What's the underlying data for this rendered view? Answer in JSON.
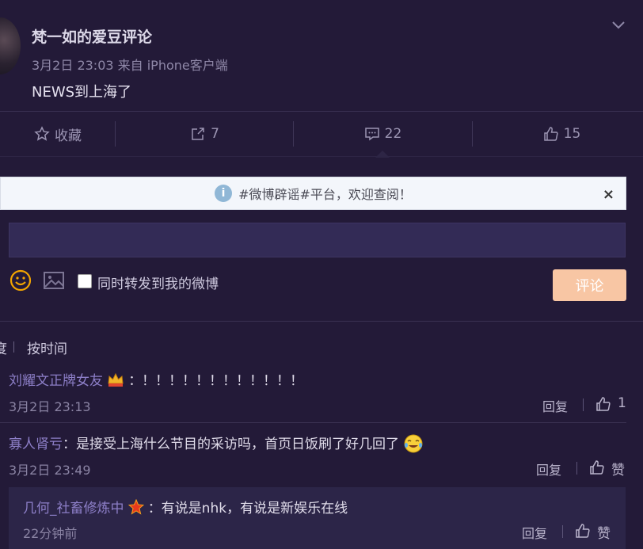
{
  "post": {
    "username": "梵一如的爱豆评论",
    "meta": "3月2日 23:03 来自 iPhone客户端",
    "text": "NEWS到上海了"
  },
  "actions": {
    "favorite_label": "收藏",
    "repost_count": "7",
    "comment_count": "22",
    "like_count": "15"
  },
  "notice": {
    "text": "#微博辟谣#平台，欢迎查阅！",
    "close": "×",
    "info": "i"
  },
  "composer": {
    "checkbox_label": "同时转发到我的微博",
    "submit_label": "评论"
  },
  "sort": {
    "partial": "度",
    "by_time": "按时间"
  },
  "comments": [
    {
      "name": "刘耀文正牌女友",
      "text": "：！！！！！！！！！！！！",
      "time": "3月2日 23:13",
      "reply": "回复",
      "likes": "1"
    },
    {
      "name": "寡人肾亏",
      "text": "：是接受上海什么节目的采访吗，首页日饭刷了好几回了",
      "time": "3月2日 23:49",
      "reply": "回复",
      "likes": "赞"
    }
  ],
  "sub_comment": {
    "name": "几何_社畜修炼中",
    "text": "：有说是nhk，有说是新娱乐在线",
    "time": "22分钟前",
    "reply": "回复",
    "likes": "赞"
  }
}
